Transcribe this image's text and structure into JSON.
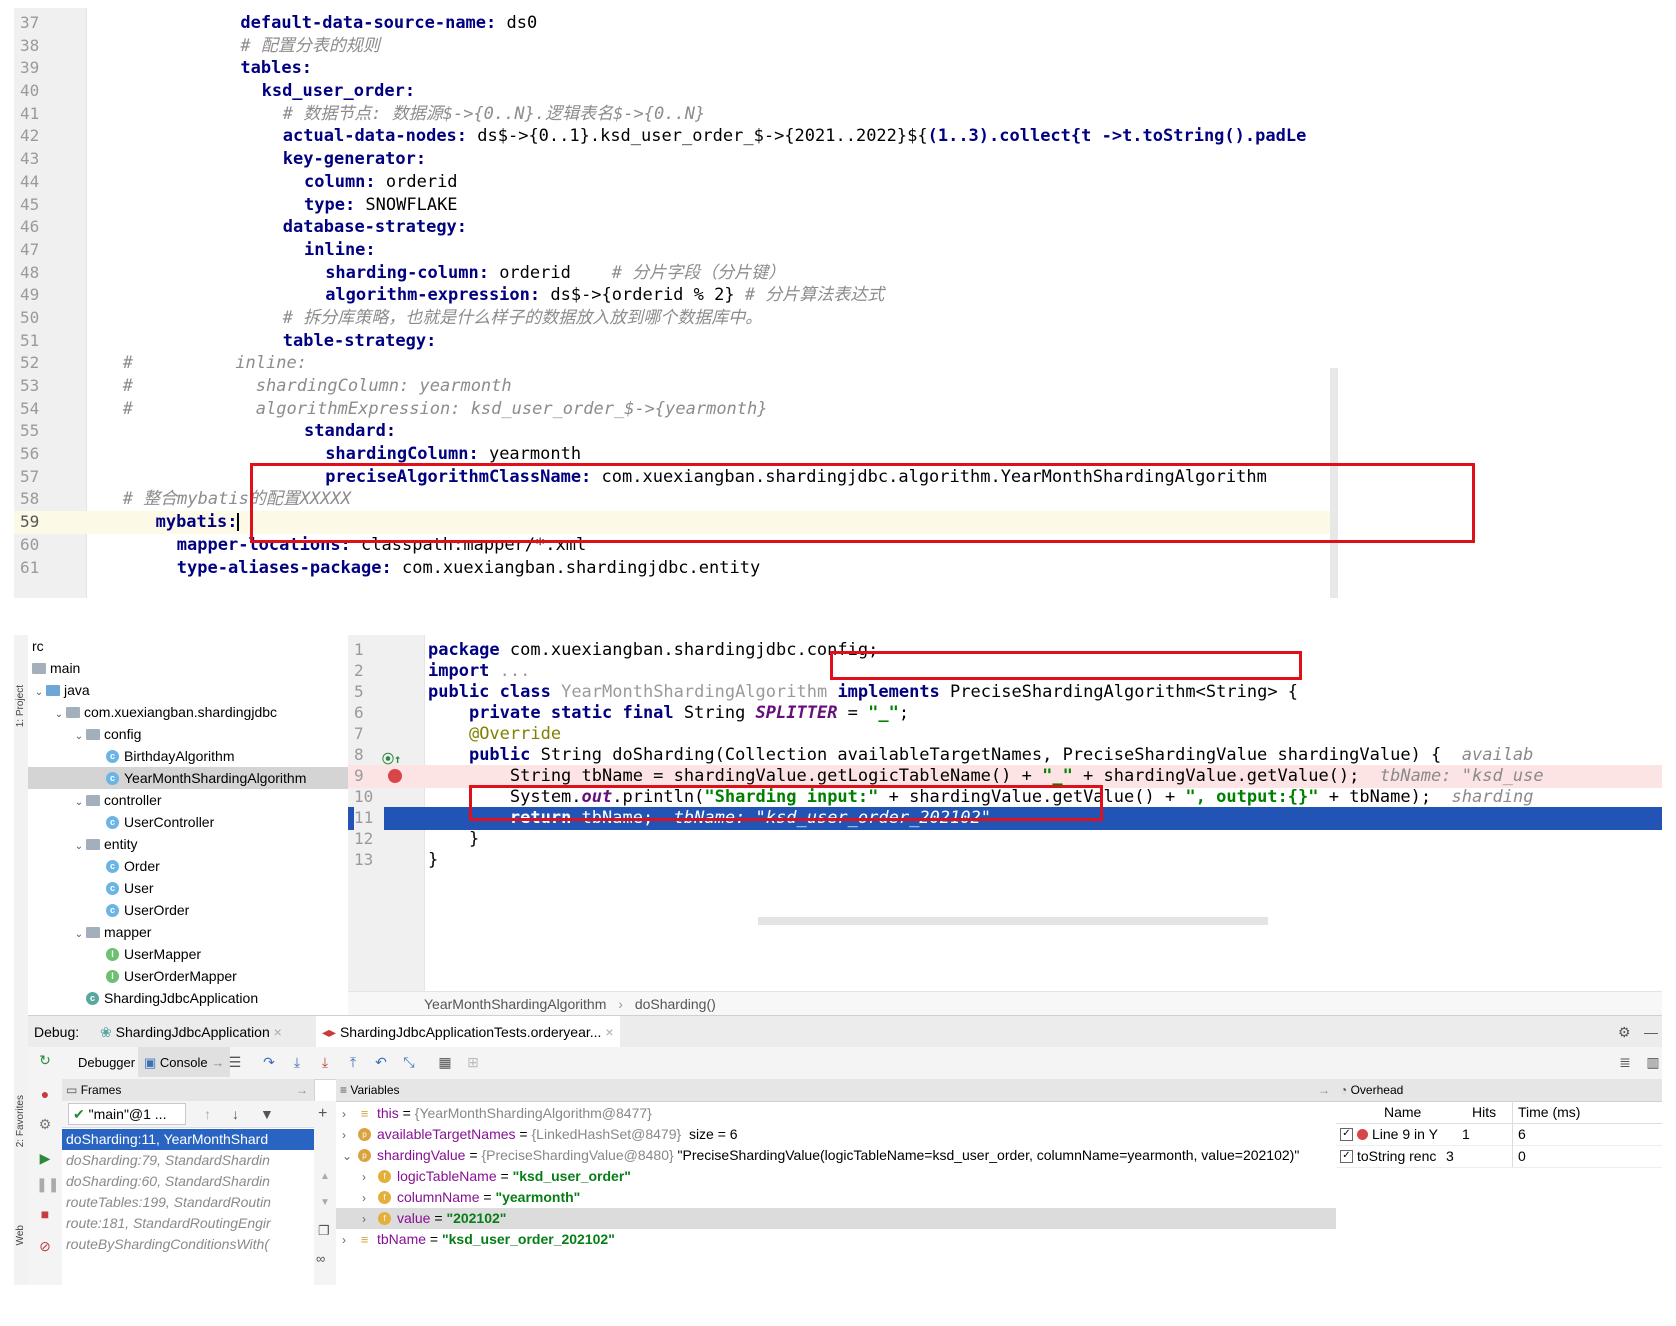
{
  "yaml": {
    "lines": [
      {
        "n": "37",
        "indent": 7,
        "parts": [
          [
            "k",
            "default-data-source-name:"
          ],
          [
            "v",
            " ds0"
          ]
        ]
      },
      {
        "n": "38",
        "indent": 7,
        "parts": [
          [
            "c",
            "# 配置分表的规则"
          ]
        ]
      },
      {
        "n": "39",
        "indent": 7,
        "parts": [
          [
            "k",
            "tables:"
          ]
        ]
      },
      {
        "n": "40",
        "indent": 8,
        "parts": [
          [
            "k",
            "ksd_user_order:"
          ]
        ]
      },
      {
        "n": "41",
        "indent": 9,
        "parts": [
          [
            "c",
            "# 数据节点: 数据源$->{0..N}.逻辑表名$->{0..N}"
          ]
        ]
      },
      {
        "n": "42",
        "indent": 9,
        "parts": [
          [
            "k",
            "actual-data-nodes:"
          ],
          [
            "v",
            " ds$->{0..1}.ksd_user_order_$->{2021..2022}${"
          ],
          [
            "s",
            "(1..3).collect{t ->t.toString().padLe"
          ]
        ]
      },
      {
        "n": "43",
        "indent": 9,
        "parts": [
          [
            "k",
            "key-generator:"
          ]
        ]
      },
      {
        "n": "44",
        "indent": 10,
        "parts": [
          [
            "k",
            "column:"
          ],
          [
            "v",
            " orderid"
          ]
        ]
      },
      {
        "n": "45",
        "indent": 10,
        "parts": [
          [
            "k",
            "type:"
          ],
          [
            "v",
            " SNOWFLAKE"
          ]
        ]
      },
      {
        "n": "46",
        "indent": 9,
        "parts": [
          [
            "k",
            "database-strategy:"
          ]
        ]
      },
      {
        "n": "47",
        "indent": 10,
        "parts": [
          [
            "k",
            "inline:"
          ]
        ]
      },
      {
        "n": "48",
        "indent": 11,
        "parts": [
          [
            "k",
            "sharding-column:"
          ],
          [
            "v",
            " orderid    "
          ],
          [
            "c",
            "# 分片字段（分片键）"
          ]
        ]
      },
      {
        "n": "49",
        "indent": 11,
        "parts": [
          [
            "k",
            "algorithm-expression:"
          ],
          [
            "v",
            " ds$->{orderid % 2} "
          ],
          [
            "c",
            "# 分片算法表达式"
          ]
        ]
      },
      {
        "n": "50",
        "indent": 9,
        "parts": [
          [
            "c",
            "# 拆分库策略，也就是什么样子的数据放入放到哪个数据库中。"
          ]
        ]
      },
      {
        "n": "51",
        "indent": 9,
        "parts": [
          [
            "k",
            "table-strategy:"
          ]
        ]
      },
      {
        "n": "52",
        "indent": 0,
        "parts": [
          [
            "c",
            "   #          inline:"
          ]
        ]
      },
      {
        "n": "53",
        "indent": 0,
        "parts": [
          [
            "c",
            "   #            shardingColumn: yearmonth"
          ]
        ]
      },
      {
        "n": "54",
        "indent": 0,
        "parts": [
          [
            "c",
            "   #            algorithmExpression: ksd_user_order_$->{yearmonth}"
          ]
        ]
      },
      {
        "n": "55",
        "indent": 10,
        "parts": [
          [
            "k",
            "standard:"
          ]
        ]
      },
      {
        "n": "56",
        "indent": 11,
        "parts": [
          [
            "k",
            "shardingColumn:"
          ],
          [
            "v",
            " yearmonth"
          ]
        ]
      },
      {
        "n": "57",
        "indent": 11,
        "parts": [
          [
            "k",
            "preciseAlgorithmClassName:"
          ],
          [
            "v",
            " com.xuexiangban.shardingjdbc.algorithm.YearMonthShardingAlgorithm"
          ]
        ]
      },
      {
        "n": "58",
        "indent": 0,
        "parts": [
          [
            "c",
            "   # 整合mybatis的配置XXXXX"
          ]
        ]
      },
      {
        "n": "59",
        "indent": 3,
        "parts": [
          [
            "k",
            "mybatis:"
          ]
        ],
        "current": true
      },
      {
        "n": "60",
        "indent": 4,
        "parts": [
          [
            "k",
            "mapper-locations:"
          ],
          [
            "v",
            " classpath:mapper/*.xml"
          ]
        ]
      },
      {
        "n": "61",
        "indent": 4,
        "parts": [
          [
            "k",
            "type-aliases-package:"
          ],
          [
            "v",
            " com.xuexiangban.shardingjdbc.entity"
          ]
        ]
      }
    ]
  },
  "tree": {
    "root": "rc",
    "main": "main",
    "java": "java",
    "pkg": "com.xuexiangban.shardingjdbc",
    "config": "config",
    "config_items": [
      "BirthdayAlgorithm",
      "YearMonthShardingAlgorithm"
    ],
    "controller": "controller",
    "controller_items": [
      "UserController"
    ],
    "entity": "entity",
    "entity_items": [
      "Order",
      "User",
      "UserOrder"
    ],
    "mapper": "mapper",
    "mapper_items": [
      "UserMapper",
      "UserOrderMapper"
    ],
    "app": "ShardingJdbcApplication",
    "side_label": "1: Project",
    "favorites_label": "2: Favorites",
    "web_label": "Web"
  },
  "java": {
    "lines": [
      {
        "n": "1",
        "parts": [
          [
            "kw",
            "package"
          ],
          [
            "t",
            " com.xuexiangban.shardingjdbc.config;"
          ]
        ]
      },
      {
        "n": "2",
        "parts": [
          [
            "kw",
            "import"
          ],
          [
            "t",
            " "
          ],
          [
            "grey",
            "..."
          ]
        ]
      },
      {
        "n": "5",
        "parts": [
          [
            "kw",
            "public class"
          ],
          [
            "t",
            " "
          ],
          [
            "grey",
            "YearMonthShardingAlgorithm"
          ],
          [
            "t",
            " "
          ],
          [
            "kw",
            "implements"
          ],
          [
            "t",
            " PreciseShardingAlgorithm<String> {"
          ]
        ]
      },
      {
        "n": "6",
        "parts": [
          [
            "t",
            "    "
          ],
          [
            "kw",
            "private static final"
          ],
          [
            "t",
            " String "
          ],
          [
            "fld",
            "SPLITTER"
          ],
          [
            "t",
            " = "
          ],
          [
            "str",
            "\"_\""
          ],
          [
            "t",
            ";"
          ]
        ]
      },
      {
        "n": "7",
        "parts": [
          [
            "t",
            "    "
          ],
          [
            "ann",
            "@Override"
          ]
        ]
      },
      {
        "n": "8",
        "parts": [
          [
            "t",
            "    "
          ],
          [
            "kw",
            "public"
          ],
          [
            "t",
            " String doSharding(Collection availableTargetNames, PreciseShardingValue shardingValue) {  "
          ],
          [
            "hint",
            "availab"
          ]
        ]
      },
      {
        "n": "9",
        "parts": [
          [
            "t",
            "        String tbName = shardingValue.getLogicTableName() + "
          ],
          [
            "str",
            "\"_\""
          ],
          [
            "t",
            " + shardingValue.getValue();  "
          ],
          [
            "hint",
            "tbName: \"ksd_use"
          ]
        ],
        "bp": true
      },
      {
        "n": "10",
        "parts": [
          [
            "t",
            "        System."
          ],
          [
            "fld",
            "out"
          ],
          [
            "t",
            ".println("
          ],
          [
            "str",
            "\"Sharding input:\""
          ],
          [
            "t",
            " + shardingValue.getValue() + "
          ],
          [
            "str",
            "\", output:{}\""
          ],
          [
            "t",
            " + tbName);  "
          ],
          [
            "hint",
            "sharding"
          ]
        ]
      },
      {
        "n": "11",
        "parts": [
          [
            "t",
            "        "
          ],
          [
            "kw",
            "return"
          ],
          [
            "t",
            " tbName;  "
          ],
          [
            "hint",
            "tbName: \"ksd_user_order_202102\""
          ]
        ],
        "exec": true
      },
      {
        "n": "12",
        "parts": [
          [
            "t",
            "    }"
          ]
        ]
      },
      {
        "n": "13",
        "parts": [
          [
            "t",
            "}"
          ]
        ]
      }
    ],
    "breadcrumb": [
      "YearMonthShardingAlgorithm",
      "doSharding()"
    ]
  },
  "debug": {
    "label": "Debug:",
    "tabs": [
      "ShardingJdbcApplication",
      "ShardingJdbcApplicationTests.orderyear..."
    ],
    "debugger_tab": "Debugger",
    "console_tab": "Console",
    "frames_header": "Frames",
    "thread": "\"main\"@1 ...",
    "frames": [
      "doSharding:11, YearMonthShard",
      "doSharding:79, StandardShardin",
      "doSharding:60, StandardShardin",
      "routeTables:199, StandardRoutin",
      "route:181, StandardRoutingEngir",
      "routeByShardingConditionsWith("
    ],
    "variables_header": "Variables",
    "variables": [
      {
        "arrow": ">",
        "icon": "≡",
        "name": "this",
        "eq": " = ",
        "ref": "{YearMonthShardingAlgorithm@8477}",
        "val": "",
        "indent": 0
      },
      {
        "arrow": ">",
        "icon": "p",
        "name": "availableTargetNames",
        "eq": " = ",
        "ref": "{LinkedHashSet@8479}",
        "val": "  size = 6",
        "indent": 0
      },
      {
        "arrow": "v",
        "icon": "p",
        "name": "shardingValue",
        "eq": " = ",
        "ref": "{PreciseShardingValue@8480}",
        "val": " \"PreciseShardingValue(logicTableName=ksd_user_order, columnName=yearmonth, value=202102)\"",
        "indent": 0
      },
      {
        "arrow": ">",
        "icon": "f",
        "name": "logicTableName",
        "eq": " = ",
        "ref": "",
        "str": "\"ksd_user_order\"",
        "indent": 1
      },
      {
        "arrow": ">",
        "icon": "f",
        "name": "columnName",
        "eq": " = ",
        "ref": "",
        "str": "\"yearmonth\"",
        "indent": 1
      },
      {
        "arrow": ">",
        "icon": "f",
        "name": "value",
        "eq": " = ",
        "ref": "",
        "str": "\"202102\"",
        "indent": 1,
        "sel": true
      },
      {
        "arrow": ">",
        "icon": "≡",
        "name": "tbName",
        "eq": " = ",
        "ref": "",
        "str": "\"ksd_user_order_202102\"",
        "indent": 0
      }
    ],
    "overhead_header": "Overhead",
    "overhead_cols": [
      "Name",
      "Hits",
      "Time (ms)"
    ],
    "overhead_rows": [
      {
        "name": "Line 9 in Y",
        "hits": "1",
        "time": "6",
        "bp": true
      },
      {
        "name": "toString renc",
        "hits": "3",
        "time": "0",
        "bp": false
      }
    ]
  }
}
